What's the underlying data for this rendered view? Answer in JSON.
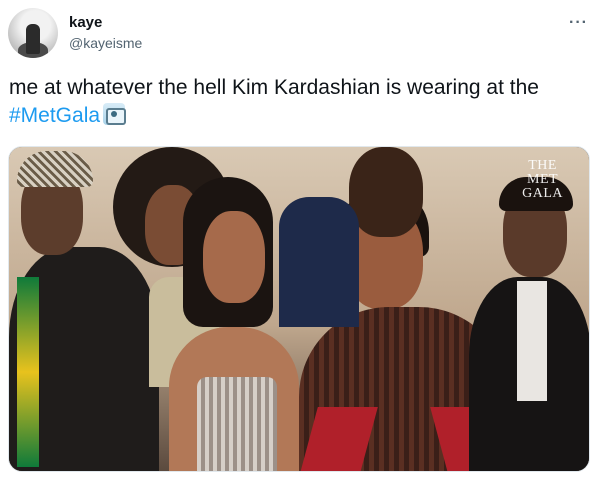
{
  "user": {
    "display_name": "kaye",
    "handle": "@kayeisme"
  },
  "tweet": {
    "text_before": "me at whatever the hell Kim Kardashian is wearing at the ",
    "hashtag": "#MetGala",
    "emoji_icon": "camera-emoji-icon"
  },
  "menu": {
    "more_label": "···"
  },
  "media": {
    "watermark_lines": [
      "THE",
      "MET",
      "GALA"
    ]
  },
  "colors": {
    "link": "#1d9bf0",
    "text": "#0f1419",
    "muted": "#536471"
  }
}
